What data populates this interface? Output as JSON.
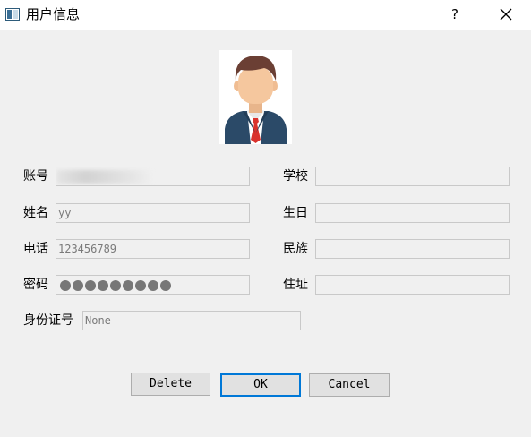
{
  "window": {
    "title": "用户信息",
    "help_label": "?"
  },
  "avatar": {
    "icon": "user-avatar-icon"
  },
  "form": {
    "account": {
      "label": "账号",
      "value": ""
    },
    "name": {
      "label": "姓名",
      "value": "yy"
    },
    "phone": {
      "label": "电话",
      "value": "123456789"
    },
    "password": {
      "label": "密码",
      "mask_count": 9
    },
    "id_number": {
      "label": "身份证号",
      "value": "None"
    },
    "school": {
      "label": "学校",
      "value": ""
    },
    "birthday": {
      "label": "生日",
      "value": ""
    },
    "ethnicity": {
      "label": "民族",
      "value": ""
    },
    "address": {
      "label": "住址",
      "value": ""
    }
  },
  "buttons": {
    "delete": "Delete",
    "ok": "OK",
    "cancel": "Cancel"
  },
  "colors": {
    "accent": "#0078d7",
    "shirt": "#2b4a68",
    "tie": "#d9322d",
    "skin": "#f5c79e",
    "hair": "#6b3f34"
  }
}
